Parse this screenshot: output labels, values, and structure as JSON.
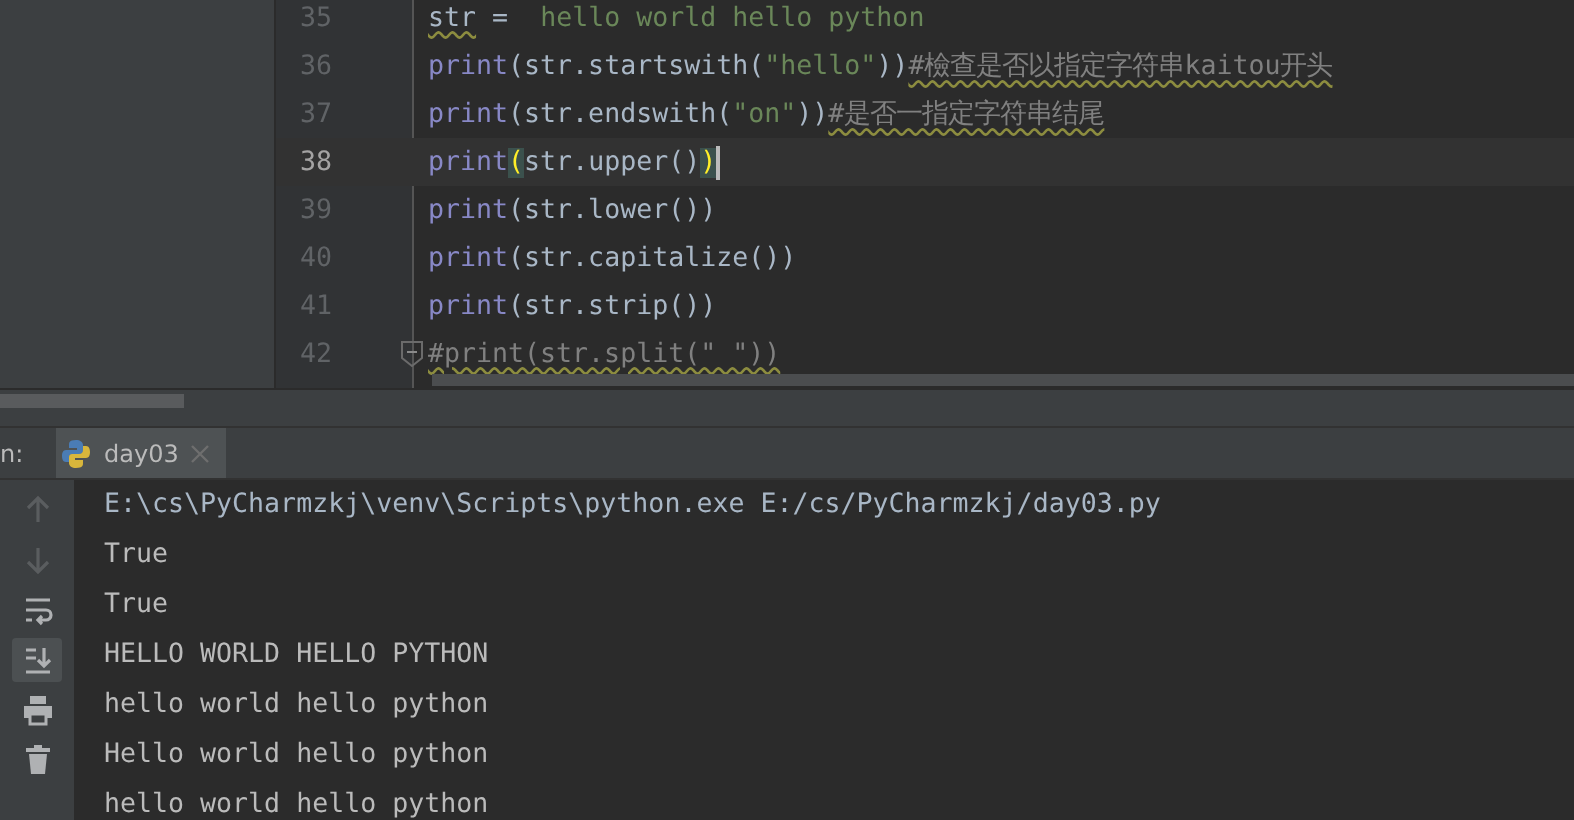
{
  "editor": {
    "lines": [
      {
        "number": "35",
        "current": false,
        "fold": false,
        "tokens": [
          {
            "kind": "plain",
            "text": "str",
            "warn": true
          },
          {
            "kind": "plain",
            "text": " = "
          },
          {
            "kind": "string",
            "text": " hello world hello python"
          }
        ]
      },
      {
        "number": "36",
        "current": false,
        "fold": false,
        "tokens": [
          {
            "kind": "builtin",
            "text": "print"
          },
          {
            "kind": "plain",
            "text": "(str.startswith("
          },
          {
            "kind": "string",
            "text": "\"hello\""
          },
          {
            "kind": "plain",
            "text": "))"
          },
          {
            "kind": "comment",
            "text": "#檢查是否以指定字符串kaitou开头",
            "warn": true
          }
        ]
      },
      {
        "number": "37",
        "current": false,
        "fold": false,
        "tokens": [
          {
            "kind": "builtin",
            "text": "print"
          },
          {
            "kind": "plain",
            "text": "(str.endswith("
          },
          {
            "kind": "string",
            "text": "\"on\""
          },
          {
            "kind": "plain",
            "text": "))"
          },
          {
            "kind": "comment",
            "text": "#是否一指定字符串结尾",
            "warn": true
          }
        ]
      },
      {
        "number": "38",
        "current": true,
        "fold": false,
        "tokens": [
          {
            "kind": "builtin",
            "text": "print"
          },
          {
            "kind": "plain",
            "text": "(",
            "match": true
          },
          {
            "kind": "plain",
            "text": "str.upper()"
          },
          {
            "kind": "plain",
            "text": ")",
            "match": true
          }
        ]
      },
      {
        "number": "39",
        "current": false,
        "fold": false,
        "tokens": [
          {
            "kind": "builtin",
            "text": "print"
          },
          {
            "kind": "plain",
            "text": "(str.lower())"
          }
        ]
      },
      {
        "number": "40",
        "current": false,
        "fold": false,
        "tokens": [
          {
            "kind": "builtin",
            "text": "print"
          },
          {
            "kind": "plain",
            "text": "(str.capitalize())"
          }
        ]
      },
      {
        "number": "41",
        "current": false,
        "fold": false,
        "tokens": [
          {
            "kind": "builtin",
            "text": "print"
          },
          {
            "kind": "plain",
            "text": "(str.strip())"
          }
        ]
      },
      {
        "number": "42",
        "current": false,
        "fold": true,
        "tokens": [
          {
            "kind": "comment",
            "text": "#print(str.split(\" \"))",
            "warn": true
          }
        ]
      }
    ]
  },
  "run_panel": {
    "label": "n:",
    "tabs": [
      {
        "label": "day03",
        "selected": true
      }
    ],
    "toolbar": [
      {
        "kind": "up",
        "disabled": true
      },
      {
        "kind": "down",
        "disabled": true
      },
      {
        "kind": "wrap",
        "disabled": false
      },
      {
        "kind": "scroll-end",
        "disabled": false,
        "on": true
      },
      {
        "kind": "print",
        "disabled": false
      },
      {
        "kind": "trash",
        "disabled": false
      }
    ],
    "console": [
      {
        "kind": "command",
        "text": "E:\\cs\\PyCharmzkj\\venv\\Scripts\\python.exe E:/cs/PyCharmzkj/day03.py"
      },
      {
        "kind": "output",
        "text": "True"
      },
      {
        "kind": "output",
        "text": "True"
      },
      {
        "kind": "output",
        "text": "HELLO WORLD HELLO PYTHON"
      },
      {
        "kind": "output",
        "text": "hello world hello python"
      },
      {
        "kind": "output",
        "text": "Hello world hello python"
      },
      {
        "kind": "output",
        "text": "hello world hello python"
      }
    ]
  }
}
